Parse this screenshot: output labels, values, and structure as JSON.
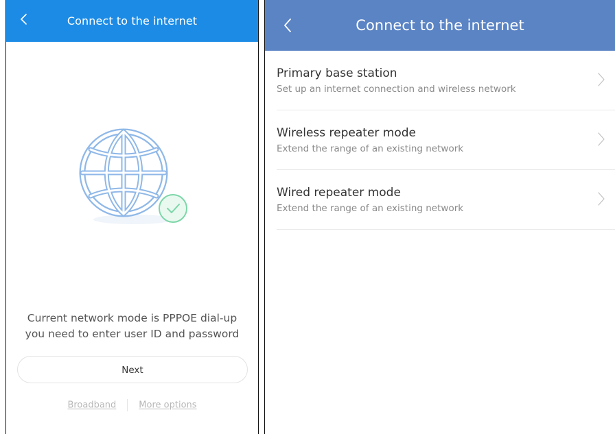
{
  "left_screen": {
    "header": {
      "title": "Connect to the internet",
      "back_icon": "chevron-left-icon"
    },
    "illustration": {
      "icon": "globe-icon",
      "badge_icon": "check-circle-icon",
      "colors": {
        "globe_stroke": "#8fb8e8",
        "badge_stroke": "#7dd6a8"
      }
    },
    "status": {
      "line1": "Current network mode is PPPOE dial-up",
      "line2": "you need to enter user ID and password"
    },
    "next_label": "Next",
    "footer": {
      "broadband_label": "Broadband",
      "more_options_label": "More options"
    },
    "accent_color": "#1c8be6"
  },
  "right_screen": {
    "header": {
      "title": "Connect to the internet",
      "back_icon": "chevron-left-icon"
    },
    "accent_color": "#5b84c5",
    "items": [
      {
        "title": "Primary base station",
        "subtitle": "Set up an internet connection and wireless network"
      },
      {
        "title": "Wireless repeater mode",
        "subtitle": "Extend the range of an existing network"
      },
      {
        "title": "Wired repeater mode",
        "subtitle": "Extend the range of an existing network"
      }
    ]
  }
}
